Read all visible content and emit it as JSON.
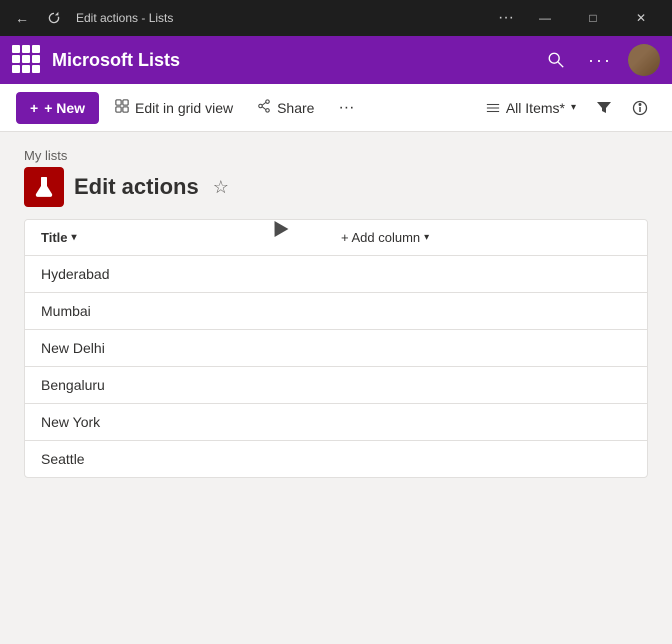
{
  "titleBar": {
    "title": "Edit actions - Lists",
    "navBack": "←",
    "navRefresh": "↻",
    "more": "···",
    "minimize": "—",
    "maximize": "□",
    "close": "✕"
  },
  "appHeader": {
    "appName": "Microsoft Lists",
    "searchIcon": "🔍",
    "moreIcon": "···"
  },
  "commandBar": {
    "newButton": "+ New",
    "editInGridView": "Edit in grid view",
    "share": "Share",
    "moreActions": "···",
    "allItems": "All Items*",
    "filterIcon": "⊟",
    "infoIcon": "ⓘ"
  },
  "breadcrumb": "My lists",
  "pageTitle": "Edit actions",
  "listItems": [
    {
      "title": "Hyderabad"
    },
    {
      "title": "Mumbai"
    },
    {
      "title": "New Delhi"
    },
    {
      "title": "Bengaluru"
    },
    {
      "title": "New York"
    },
    {
      "title": "Seattle"
    }
  ],
  "tableHeaders": {
    "title": "Title",
    "addColumn": "+ Add column"
  }
}
